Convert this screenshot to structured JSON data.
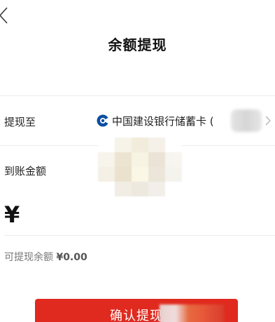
{
  "header": {
    "title": "余额提现",
    "back_icon": "back-chevron-icon"
  },
  "withdraw_to": {
    "label": "提现至",
    "bank_name": "中国建设银行储蓄卡 (",
    "bank_logo_icon": "ccb-bank-logo-icon",
    "chevron_icon": "chevron-right-icon"
  },
  "arrival_amount": {
    "label": "到账金额"
  },
  "amount": {
    "currency_symbol": "¥",
    "value": ""
  },
  "balance": {
    "label": "可提现余额",
    "value": "¥0.00"
  },
  "confirm_button": {
    "label": "确认提现"
  },
  "colors": {
    "primary_red": "#e02a1f",
    "bank_blue": "#0a4ea2",
    "divider": "#ececec"
  }
}
